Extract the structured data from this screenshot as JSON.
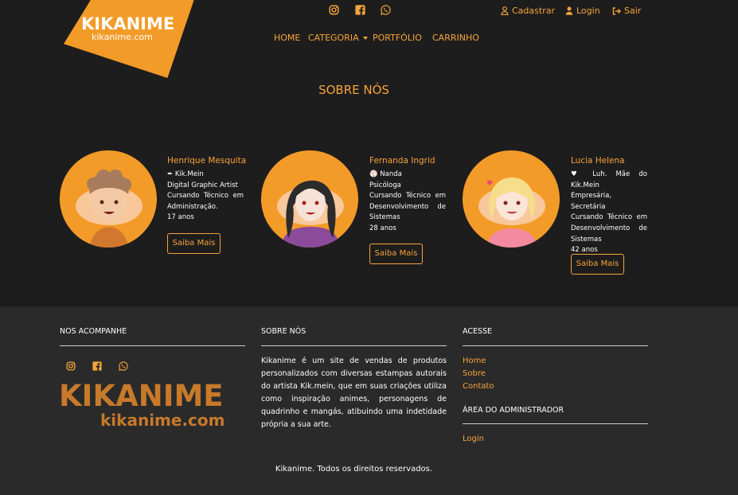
{
  "logo": {
    "title": "KIKANIME",
    "subtitle": "kikanime.com"
  },
  "header_social": [
    {
      "icon": "instagram-icon"
    },
    {
      "icon": "facebook-icon"
    },
    {
      "icon": "whatsapp-icon"
    }
  ],
  "user_menu": {
    "register": "Cadastrar",
    "login": "Login",
    "logout": "Sair"
  },
  "nav": {
    "home": "HOME",
    "category": "CATEGORIA",
    "portfolio": "PORTFÓLIO",
    "cart": "CARRINHO"
  },
  "section_title": "SOBRE NÓS",
  "team": [
    {
      "name": "Henrique Mesquita",
      "handle": "Kik.Mein",
      "lines": [
        "Digital Graphic Artist",
        "Cursando Técnico em Administração."
      ],
      "age": "17 anos",
      "button": "Saiba Mais"
    },
    {
      "name": "Fernanda Ingrid",
      "handle": "Nanda",
      "lines": [
        "Psicóloga",
        "Cursando Técnico em Desenvolvimento de Sistemas"
      ],
      "age": "28 anos",
      "button": "Saiba Mais"
    },
    {
      "name": "Lucia Helena",
      "handle": "Luh. Mãe do Kik.Mein",
      "lines": [
        "Empresária, Secretária",
        "Cursando Técnico em Desenvolvimento de Sistemas"
      ],
      "age": "42 anos",
      "button": "Saiba Mais"
    }
  ],
  "footer": {
    "follow_title": "NOS ACOMPANHE",
    "about_title": "SOBRE NÓS",
    "about_text": "Kikanime é um site de vendas de produtos personalizados com diversas estampas autorais do artista Kik.mein, que em suas criações utiliza como inspiração animes, personagens de quadrinho e mangás, atibuindo uma indetidade própria a sua arte.",
    "access_title": "ACESSE",
    "access_links": [
      "Home",
      "Sobre",
      "Contato"
    ],
    "admin_title": "ÁREA DO ADMINISTRADOR",
    "admin_link": "Login",
    "logo_title": "KIKANIME",
    "logo_subtitle": "kikanime.com",
    "copyright": "Kikanime. Todos os direitos reservados."
  },
  "colors": {
    "accent": "#f6a33a",
    "background": "#1e1d1e",
    "footer": "#2b2a2b"
  }
}
